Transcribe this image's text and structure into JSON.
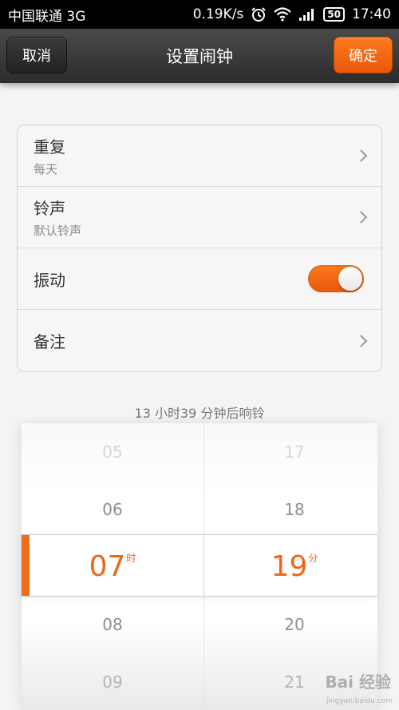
{
  "status_bar": {
    "carrier": "中国联通 3G",
    "speed": "0.19K/s",
    "battery": "50",
    "time": "17:40"
  },
  "header": {
    "cancel_label": "取消",
    "title": "设置闹钟",
    "confirm_label": "确定"
  },
  "settings": {
    "repeat": {
      "label": "重复",
      "value": "每天"
    },
    "ringtone": {
      "label": "铃声",
      "value": "默认铃声"
    },
    "vibrate": {
      "label": "振动",
      "on": true
    },
    "note": {
      "label": "备注"
    }
  },
  "countdown": "13 小时39 分钟后响铃",
  "picker": {
    "hours": {
      "above2": "05",
      "above1": "06",
      "selected": "07",
      "below1": "08",
      "below2": "09",
      "unit": "时"
    },
    "minutes": {
      "above2": "17",
      "above1": "18",
      "selected": "19",
      "below1": "20",
      "below2": "21",
      "unit": "分"
    }
  },
  "watermark": {
    "main": "Bai 经验",
    "sub": "jingyan.baidu.com"
  },
  "colors": {
    "accent": "#f26c17",
    "header_bg": "#2c2c2c"
  }
}
